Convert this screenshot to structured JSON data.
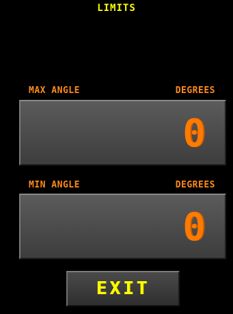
{
  "screen": {
    "title": "LIMITS"
  },
  "max": {
    "label": "MAX ANGLE",
    "unit_label": "DEGREES",
    "value": "0"
  },
  "min": {
    "label": "MIN ANGLE",
    "unit_label": "DEGREES",
    "value": "0"
  },
  "exit": {
    "label": "EXIT"
  },
  "colors": {
    "background": "#000000",
    "title_yellow": "#ffff00",
    "label_orange": "#ff8c1a",
    "digit_orange": "#ff7a00",
    "panel_gray": "#4a4a4a"
  }
}
